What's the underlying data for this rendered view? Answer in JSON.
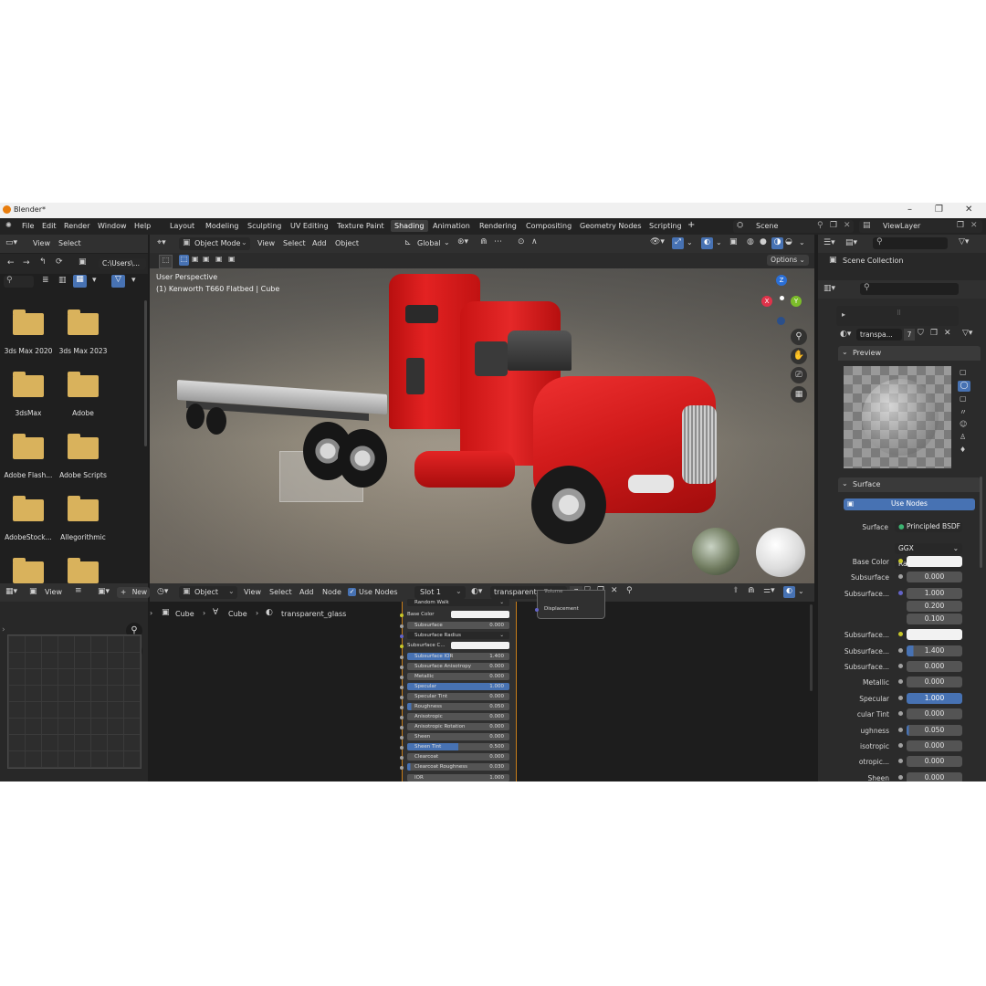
{
  "window": {
    "title": "Blender*"
  },
  "menu": [
    "File",
    "Edit",
    "Render",
    "Window",
    "Help"
  ],
  "workspaces": [
    "Layout",
    "Modeling",
    "Sculpting",
    "UV Editing",
    "Texture Paint",
    "Shading",
    "Animation",
    "Rendering",
    "Compositing",
    "Geometry Nodes",
    "Scripting",
    "+"
  ],
  "active_workspace": "Shading",
  "scene": {
    "name": "Scene",
    "view_layer": "ViewLayer"
  },
  "file_browser": {
    "menu": [
      "View",
      "Select"
    ],
    "path": "C:\\Users\\...",
    "folders": [
      "3ds Max 2020",
      "3ds Max 2023",
      "3dsMax",
      "Adobe",
      "Adobe Flash...",
      "Adobe Scripts",
      "AdobeStock...",
      "Allegorithmic",
      "",
      ""
    ]
  },
  "viewport": {
    "mode": "Object Mode",
    "menu": [
      "View",
      "Select",
      "Add",
      "Object"
    ],
    "transform": "Global",
    "options": "Options",
    "overlay_line1": "User Perspective",
    "overlay_line2": "(1) Kenworth T660 Flatbed | Cube",
    "gizmo": {
      "z": "Z",
      "x": "X",
      "y": "Y"
    }
  },
  "image_editor": {
    "view": "View",
    "new": "New"
  },
  "node_editor": {
    "mode": "Object",
    "menu": [
      "View",
      "Select",
      "Add",
      "Node"
    ],
    "use_nodes": "Use Nodes",
    "slot": "Slot 1",
    "material": "transparent_glass",
    "users": "7",
    "breadcrumb": [
      "Cube",
      "Cube",
      "transparent_glass"
    ],
    "output_node_rows": [
      "Volume",
      "Displacement"
    ],
    "bsdf_rows": [
      {
        "name": "Random Walk",
        "value": "",
        "style": "dropdown"
      },
      {
        "name": "Base Color",
        "value": "",
        "style": "color"
      },
      {
        "name": "Subsurface",
        "value": "0.000",
        "style": "normal"
      },
      {
        "name": "Subsurface Radius",
        "value": "",
        "style": "dropdown"
      },
      {
        "name": "Subsurface C...",
        "value": "",
        "style": "color"
      },
      {
        "name": "Subsurface IOR",
        "value": "1.400",
        "style": "normal"
      },
      {
        "name": "Subsurface Anisotropy",
        "value": "0.000",
        "style": "normal"
      },
      {
        "name": "Metallic",
        "value": "0.000",
        "style": "normal"
      },
      {
        "name": "Specular",
        "value": "1.000",
        "style": "blue"
      },
      {
        "name": "Specular Tint",
        "value": "0.000",
        "style": "normal"
      },
      {
        "name": "Roughness",
        "value": "0.050",
        "style": "normal"
      },
      {
        "name": "Anisotropic",
        "value": "0.000",
        "style": "normal"
      },
      {
        "name": "Anisotropic Rotation",
        "value": "0.000",
        "style": "normal"
      },
      {
        "name": "Sheen",
        "value": "0.000",
        "style": "normal"
      },
      {
        "name": "Sheen Tint",
        "value": "0.500",
        "style": "half"
      },
      {
        "name": "Clearcoat",
        "value": "0.000",
        "style": "normal"
      },
      {
        "name": "Clearcoat Roughness",
        "value": "0.030",
        "style": "normal"
      },
      {
        "name": "IOR",
        "value": "1.000",
        "style": "normal"
      }
    ]
  },
  "outliner": {
    "scene_collection": "Scene Collection"
  },
  "properties": {
    "material_name": "transpa...",
    "users": "7",
    "preview": "Preview",
    "surface_panel": "Surface",
    "use_nodes": "Use Nodes",
    "surface_label": "Surface",
    "surface_value": "Principled BSDF",
    "distribution": "GGX",
    "subsurface_method": "Random Walk",
    "rows": [
      {
        "label": "Base Color",
        "value": "",
        "style": "white"
      },
      {
        "label": "Subsurface",
        "value": "0.000",
        "style": "normal"
      },
      {
        "label": "Subsurface...",
        "value": "1.000",
        "style": "normal"
      },
      {
        "label": "",
        "value": "0.200",
        "style": "normal"
      },
      {
        "label": "",
        "value": "0.100",
        "style": "normal"
      },
      {
        "label": "Subsurface...",
        "value": "",
        "style": "white"
      },
      {
        "label": "Subsurface...",
        "value": "1.400",
        "style": "normal"
      },
      {
        "label": "Subsurface...",
        "value": "0.000",
        "style": "normal"
      },
      {
        "label": "Metallic",
        "value": "0.000",
        "style": "normal"
      },
      {
        "label": "Specular",
        "value": "1.000",
        "style": "blue"
      },
      {
        "label": "cular Tint",
        "value": "0.000",
        "style": "normal"
      },
      {
        "label": "ughness",
        "value": "0.050",
        "style": "normal"
      },
      {
        "label": "isotropic",
        "value": "0.000",
        "style": "normal"
      },
      {
        "label": "otropic...",
        "value": "0.000",
        "style": "normal"
      },
      {
        "label": "Sheen",
        "value": "0.000",
        "style": "normal"
      }
    ]
  }
}
